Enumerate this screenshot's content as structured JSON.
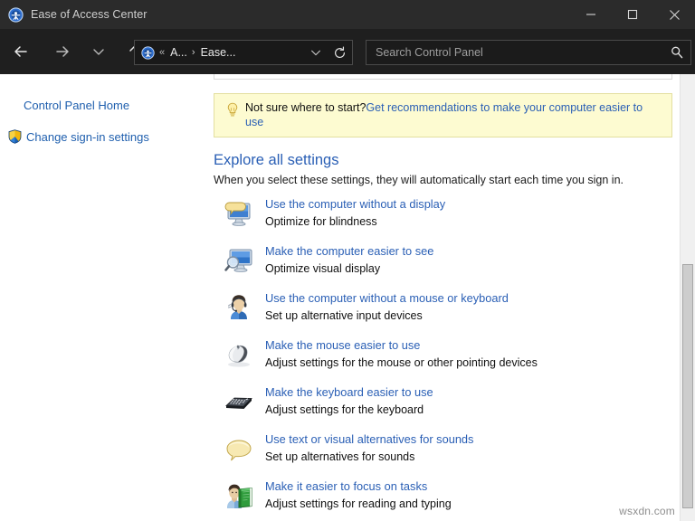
{
  "window": {
    "title": "Ease of Access Center",
    "icon": "ease-of-access-icon",
    "minimize_label": "—",
    "maximize_label": "□",
    "close_label": "✕"
  },
  "nav": {
    "back_label": "←",
    "forward_label": "→",
    "recent_label": "⌄",
    "up_label": "↑",
    "address": {
      "icon": "ease-of-access-icon",
      "overflow_label": "«",
      "crumbs": [
        "A...",
        "Ease..."
      ],
      "separator": "›",
      "dropdown_label": "⌄",
      "refresh_label": "⟳"
    },
    "search": {
      "placeholder": "Search Control Panel",
      "value": "",
      "icon": "search-icon"
    }
  },
  "sidebar": {
    "items": [
      {
        "label": "Control Panel Home",
        "icon": null
      },
      {
        "label": "Change sign-in settings",
        "icon": "uac-shield-icon"
      }
    ]
  },
  "main": {
    "tip": {
      "icon": "lightbulb-icon",
      "prompt": "Not sure where to start?",
      "link": "Get recommendations to make your computer easier to use"
    },
    "heading": "Explore all settings",
    "subheading": "When you select these settings, they will automatically start each time you sign in.",
    "settings": [
      {
        "icon": "monitor-speech-icon",
        "title": "Use the computer without a display",
        "desc": "Optimize for blindness"
      },
      {
        "icon": "monitor-magnifier-icon",
        "title": "Make the computer easier to see",
        "desc": "Optimize visual display"
      },
      {
        "icon": "person-headset-icon",
        "title": "Use the computer without a mouse or keyboard",
        "desc": "Set up alternative input devices"
      },
      {
        "icon": "mouse-icon",
        "title": "Make the mouse easier to use",
        "desc": "Adjust settings for the mouse or other pointing devices"
      },
      {
        "icon": "keyboard-icon",
        "title": "Make the keyboard easier to use",
        "desc": "Adjust settings for the keyboard"
      },
      {
        "icon": "speech-bubble-icon",
        "title": "Use text or visual alternatives for sounds",
        "desc": "Set up alternatives for sounds"
      },
      {
        "icon": "person-book-icon",
        "title": "Make it easier to focus on tasks",
        "desc": "Adjust settings for reading and typing"
      }
    ]
  },
  "watermark": "wsxdn.com",
  "colors": {
    "titlebar_bg": "#2b2b2b",
    "navbar_bg": "#1f1f1f",
    "link_blue": "#2a5fb5",
    "sidebar_link": "#1f5fae",
    "tip_bg": "#fdfbd1",
    "tip_border": "#e3dfa0",
    "content_bg": "#ffffff"
  }
}
